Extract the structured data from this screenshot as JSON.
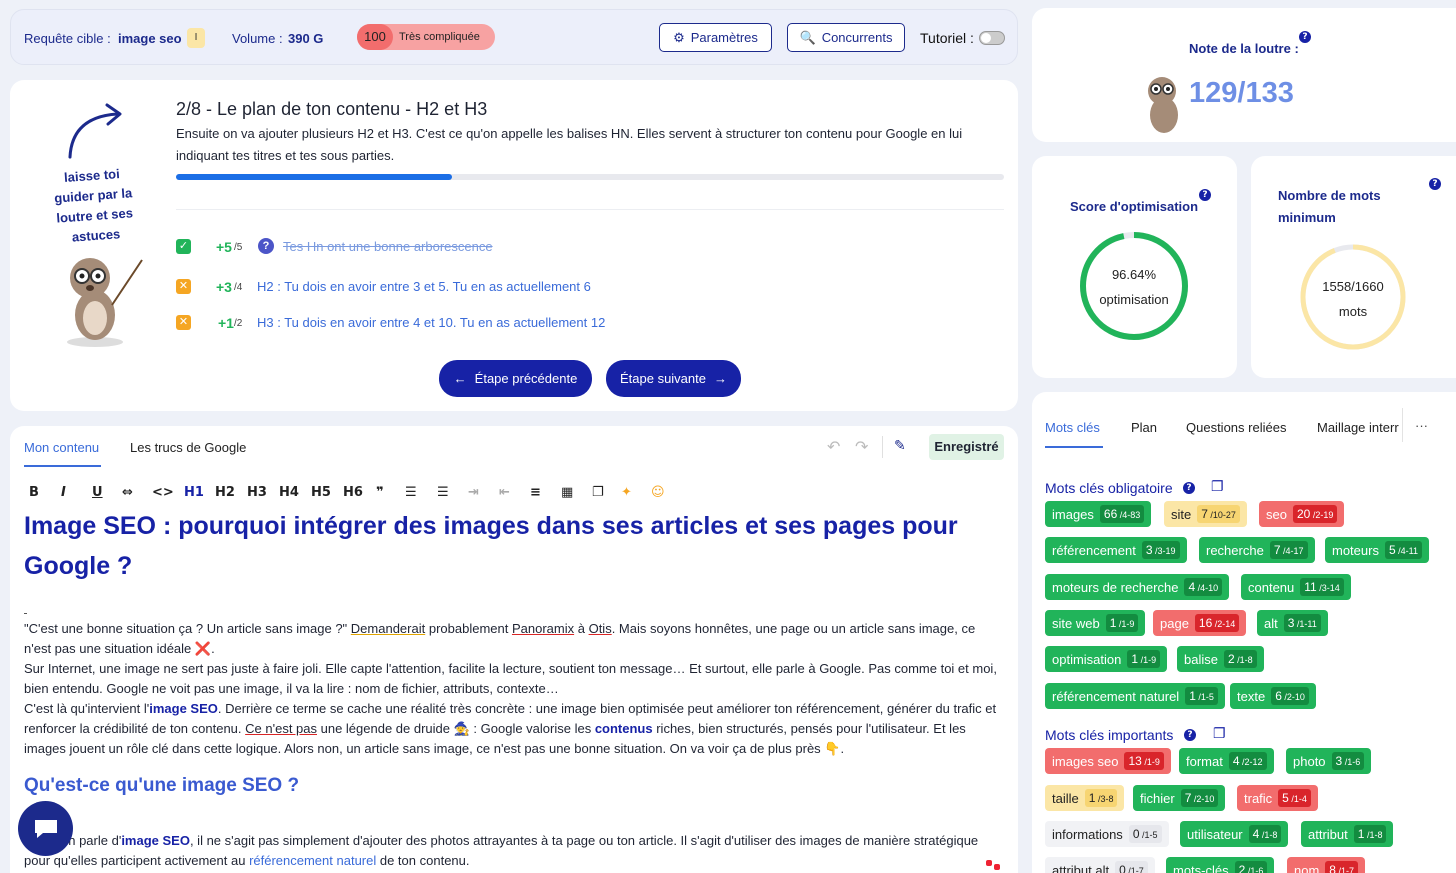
{
  "header": {
    "target_label": "Requête cible :",
    "target_value": "image seo",
    "target_badge": "I",
    "volume_label": "Volume :",
    "volume_value": "390 G",
    "difficulty_score": "100",
    "difficulty_label": "Très compliquée",
    "params_button": "Paramètres",
    "competitors_button": "Concurrents",
    "tutorial_label": "Tutoriel :"
  },
  "guide": {
    "mascot_text": "laisse toi guider par la loutre et ses astuces",
    "step_title": "2/8 - Le plan de ton contenu - H2 et H3",
    "step_desc": "Ensuite on va ajouter plusieurs H2 et H3. C'est ce qu'on appelle les balises HN. Elles servent à structurer ton contenu pour Google en lui indiquant tes titres et tes sous parties.",
    "progress": 0.333,
    "checks": [
      {
        "points": "+5",
        "max": "/5",
        "text": "Tes Hn ont une bonne arborescence",
        "status": "done"
      },
      {
        "points": "+3",
        "max": "/4",
        "text": "H2 : Tu dois en avoir entre 3 et 5. Tu en as actuellement 6",
        "status": "warn"
      },
      {
        "points": "+1",
        "max": "/2",
        "text": "H3 : Tu dois en avoir entre 4 et 10. Tu en as actuellement 12",
        "status": "warn"
      }
    ],
    "prev_button": "Étape précédente",
    "next_button": "Étape suivante"
  },
  "editor": {
    "tab_content": "Mon contenu",
    "tab_google": "Les trucs de Google",
    "saved": "Enregistré",
    "toolbar": [
      "B",
      "I",
      "U",
      "⇔",
      "<>",
      "H1",
      "H2",
      "H3",
      "H4",
      "H5",
      "H6",
      "❞"
    ],
    "h1": "Image SEO : pourquoi intégrer des images dans ses articles et ses pages pour Google ?",
    "p1a": "\"C'est une bonne situation ça ? Un article sans image ?\" ",
    "p1b": "Demanderait",
    "p1c": " probablement ",
    "p1d": "Panoramix",
    "p1e": " à ",
    "p1f": "Otis",
    "p1g": ". Mais soyons honnêtes, une page ou un article sans image, ce n'est pas une situation idéale ❌.",
    "p2": "Sur Internet, une image ne sert pas juste à faire joli. Elle capte l'attention, facilite la lecture, soutient ton message… Et surtout, elle parle à Google. Pas comme toi et moi, bien entendu. Google ne voit pas une image, il va la lire : nom de fichier, attributs, contexte…",
    "p3a": "C'est là qu'intervient l'",
    "p3b": "image SEO",
    "p3c": ". Derrière ce terme se cache une réalité très concrète : une image bien optimisée peut améliorer ton référencement, générer du trafic et renforcer la crédibilité de ton contenu. ",
    "p3d": "Ce n'est pas",
    "p3e": " une légende de druide 🧙 : Google valorise les ",
    "p3f": "contenus",
    "p3g": " riches, bien structurés, pensés pour l'utilisateur. Et les images jouent un rôle clé dans cette logique. Alors non, un article sans image, ce n'est pas une bonne situation. On va voir ça de plus près 👇.",
    "h2": "Qu'est-ce qu'une image SEO ?",
    "p4a": "on parle d'",
    "p4b": "image SEO",
    "p4c": ", il ne s'agit pas simplement d'ajouter des photos attrayantes à ta page ou ton article. Il s'agit d'utiliser des images de manière stratégique pour qu'elles participent activement au ",
    "p4d": "référencement naturel",
    "p4e": " de ton contenu."
  },
  "score": {
    "loutre_label": "Note de la loutre :",
    "loutre_value": "129/133",
    "opt_label": "Score d'optimisation",
    "opt_value": "96.64%",
    "opt_unit": "optimisation",
    "opt_pct": 96.64,
    "words_label": "Nombre de mots minimum",
    "words_value": "1558/1660",
    "words_unit": "mots",
    "words_pct": 93.9
  },
  "tabs": [
    "Mots clés",
    "Plan",
    "Questions reliées",
    "Maillage interr",
    "···"
  ],
  "kw_required_title": "Mots clés obligatoire",
  "kw_important_title": "Mots clés importants",
  "kw_required": [
    [
      "images",
      "66",
      "/4-83",
      "g"
    ],
    [
      "site",
      "7",
      "/10-27",
      "y"
    ],
    [
      "seo",
      "20",
      "/2-19",
      "rd"
    ],
    [
      "référencement",
      "3",
      "/3-19",
      "g"
    ],
    [
      "recherche",
      "7",
      "/4-17",
      "g"
    ],
    [
      "moteurs",
      "5",
      "/4-11",
      "g"
    ],
    [
      "moteurs de recherche",
      "4",
      "/4-10",
      "g"
    ],
    [
      "contenu",
      "11",
      "/3-14",
      "g"
    ],
    [
      "site web",
      "1",
      "/1-9",
      "g"
    ],
    [
      "page",
      "16",
      "/2-14",
      "rd"
    ],
    [
      "alt",
      "3",
      "/1-11",
      "g"
    ],
    [
      "optimisation",
      "1",
      "/1-9",
      "g"
    ],
    [
      "balise",
      "2",
      "/1-8",
      "g"
    ],
    [
      "référencement naturel",
      "1",
      "/1-5",
      "g"
    ],
    [
      "texte",
      "6",
      "/2-10",
      "g"
    ]
  ],
  "kw_important": [
    [
      "images seo",
      "13",
      "/1-9",
      "rd"
    ],
    [
      "format",
      "4",
      "/2-12",
      "g"
    ],
    [
      "photo",
      "3",
      "/1-6",
      "g"
    ],
    [
      "taille",
      "1",
      "/3-8",
      "y"
    ],
    [
      "fichier",
      "7",
      "/2-10",
      "g"
    ],
    [
      "trafic",
      "5",
      "/1-4",
      "rd"
    ],
    [
      "informations",
      "0",
      "/1-5",
      "gr"
    ],
    [
      "utilisateur",
      "4",
      "/1-8",
      "g"
    ],
    [
      "attribut",
      "1",
      "/1-8",
      "g"
    ],
    [
      "attribut alt",
      "0",
      "/1-7",
      "gr"
    ],
    [
      "mots-clés",
      "2",
      "/1-6",
      "g"
    ],
    [
      "nom",
      "8",
      "/1-7",
      "rd"
    ]
  ],
  "colors": {
    "primary": "#1722a6",
    "green": "#21b45a",
    "red": "#f26d6d",
    "yellow": "#fbe6a6"
  }
}
